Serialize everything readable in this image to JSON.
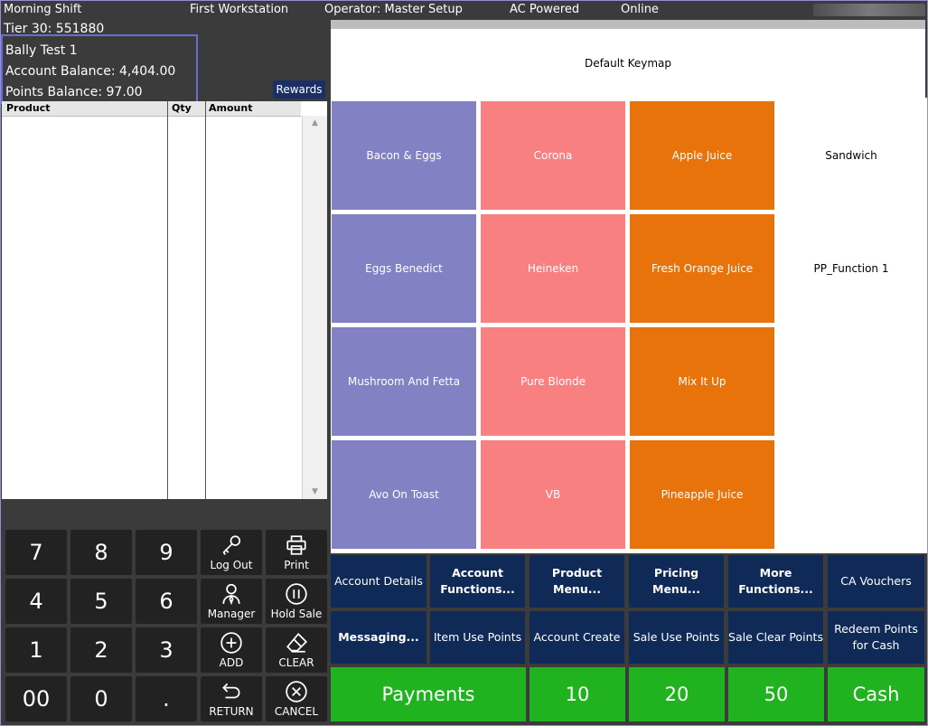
{
  "status": {
    "shift": "Morning Shift",
    "workstation": "First Workstation",
    "operator": "Operator: Master Setup",
    "power": "AC Powered",
    "connection": "Online"
  },
  "account": {
    "tier": "Tier 30: 551880",
    "name": "Bally Test 1",
    "account_balance": "Account Balance: 4,404.00",
    "points_balance": "Points Balance: 97.00",
    "rewards_label": "Rewards"
  },
  "grid": {
    "columns": [
      "Product",
      "Qty",
      "Amount"
    ]
  },
  "keypad": {
    "keys": [
      "7",
      "8",
      "9",
      "4",
      "5",
      "6",
      "1",
      "2",
      "3",
      "00",
      "0",
      "."
    ],
    "log_out": "Log Out",
    "print": "Print",
    "manager": "Manager",
    "hold_sale": "Hold Sale",
    "add": "ADD",
    "clear": "CLEAR",
    "return": "RETURN",
    "cancel": "CANCEL"
  },
  "keymap": {
    "title": "Default Keymap"
  },
  "products": [
    [
      "Bacon & Eggs",
      "Corona",
      "Apple Juice",
      "Sandwich"
    ],
    [
      "Eggs Benedict",
      "Heineken",
      "Fresh Orange Juice",
      "PP_Function 1"
    ],
    [
      "Mushroom And Fetta",
      "Pure Blonde",
      "Mix It Up",
      ""
    ],
    [
      "Avo On Toast",
      "VB",
      "Pineapple Juice",
      ""
    ]
  ],
  "colors": {
    "food": "#8181c4",
    "beer": "#f98080",
    "juice": "#e8730b",
    "function": "#0f2a57",
    "tender": "#21b21f"
  },
  "functions": {
    "row1": [
      "Account Details",
      "Account Functions...",
      "Product Menu...",
      "Pricing Menu...",
      "More Functions...",
      "CA Vouchers"
    ],
    "row2": [
      "Messaging...",
      "Item Use Points",
      "Account Create",
      "Sale Use Points",
      "Sale Clear Points",
      "Redeem Points for Cash"
    ]
  },
  "tenders": [
    "Payments",
    "10",
    "20",
    "50",
    "Cash"
  ]
}
